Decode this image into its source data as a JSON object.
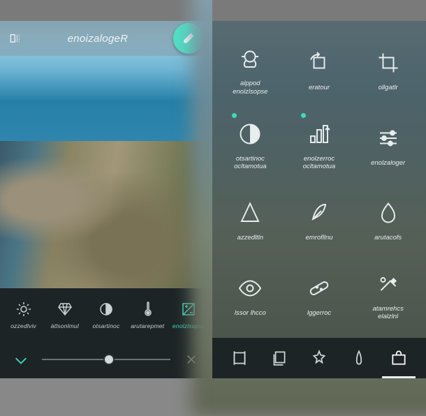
{
  "left": {
    "header_title": "enoizalogeR",
    "tools": [
      {
        "id": "vividezza",
        "label": "ozzedlviv"
      },
      {
        "id": "luminosita",
        "label": "àtlsonlmul"
      },
      {
        "id": "contrasto",
        "label": "otsartinoc"
      },
      {
        "id": "temperatura",
        "label": "arutarepmet"
      },
      {
        "id": "esposizione",
        "label": "enolzlsopse",
        "active": true
      }
    ],
    "slider_value": 50
  },
  "right": {
    "grid": [
      {
        "id": "doppia-esposizione",
        "label": "alppod\nenolzlsopse"
      },
      {
        "id": "ruotare",
        "label": "eratour"
      },
      {
        "id": "ritaglio",
        "label": "ollgatlr"
      },
      {
        "id": "contrasto-auto",
        "label": "otsartinoc\nocltamotua",
        "dot": true
      },
      {
        "id": "correzione-auto",
        "label": "enolzerroc\nocltamotua",
        "dot": true
      },
      {
        "id": "regolazione",
        "label": "enolzaloger"
      },
      {
        "id": "nitidezza",
        "label": "azzedltln"
      },
      {
        "id": "uniforme",
        "label": "emrofllnu"
      },
      {
        "id": "sfocatura",
        "label": "arutacofs"
      },
      {
        "id": "occhi-rossi",
        "label": "lssor lhcco"
      },
      {
        "id": "correggi",
        "label": "lggerroc"
      },
      {
        "id": "schermata-iniziale",
        "label": "atamrehcs\nelalzlnl"
      }
    ]
  }
}
